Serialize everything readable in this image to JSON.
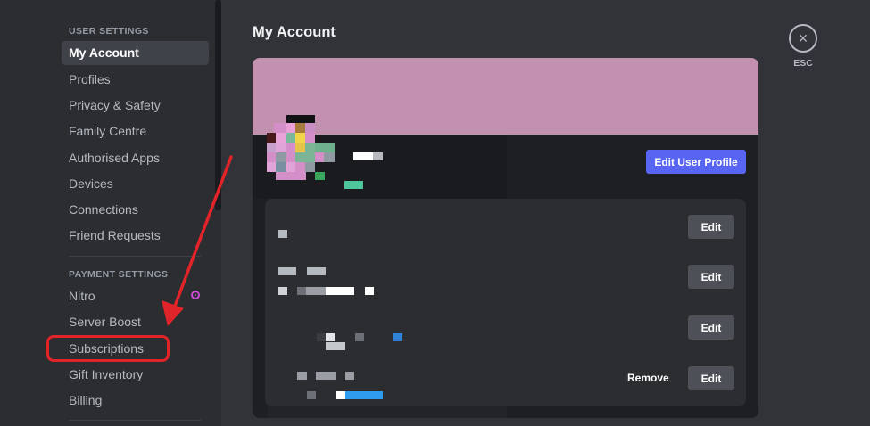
{
  "sidebar": {
    "user_settings_header": "USER SETTINGS",
    "user_items": [
      {
        "label": "My Account"
      },
      {
        "label": "Profiles"
      },
      {
        "label": "Privacy & Safety"
      },
      {
        "label": "Family Centre"
      },
      {
        "label": "Authorised Apps"
      },
      {
        "label": "Devices"
      },
      {
        "label": "Connections"
      },
      {
        "label": "Friend Requests"
      }
    ],
    "payment_settings_header": "PAYMENT SETTINGS",
    "payment_items": [
      {
        "label": "Nitro"
      },
      {
        "label": "Server Boost"
      },
      {
        "label": "Subscriptions"
      },
      {
        "label": "Gift Inventory"
      },
      {
        "label": "Billing"
      }
    ]
  },
  "main": {
    "title": "My Account",
    "close_icon": "×",
    "esc_label": "ESC",
    "edit_profile_label": "Edit User Profile",
    "edit_label": "Edit",
    "remove_label": "Remove"
  },
  "colors": {
    "banner": "#c291b0",
    "brand_button": "#5865f2",
    "annotation": "#e0242a"
  }
}
